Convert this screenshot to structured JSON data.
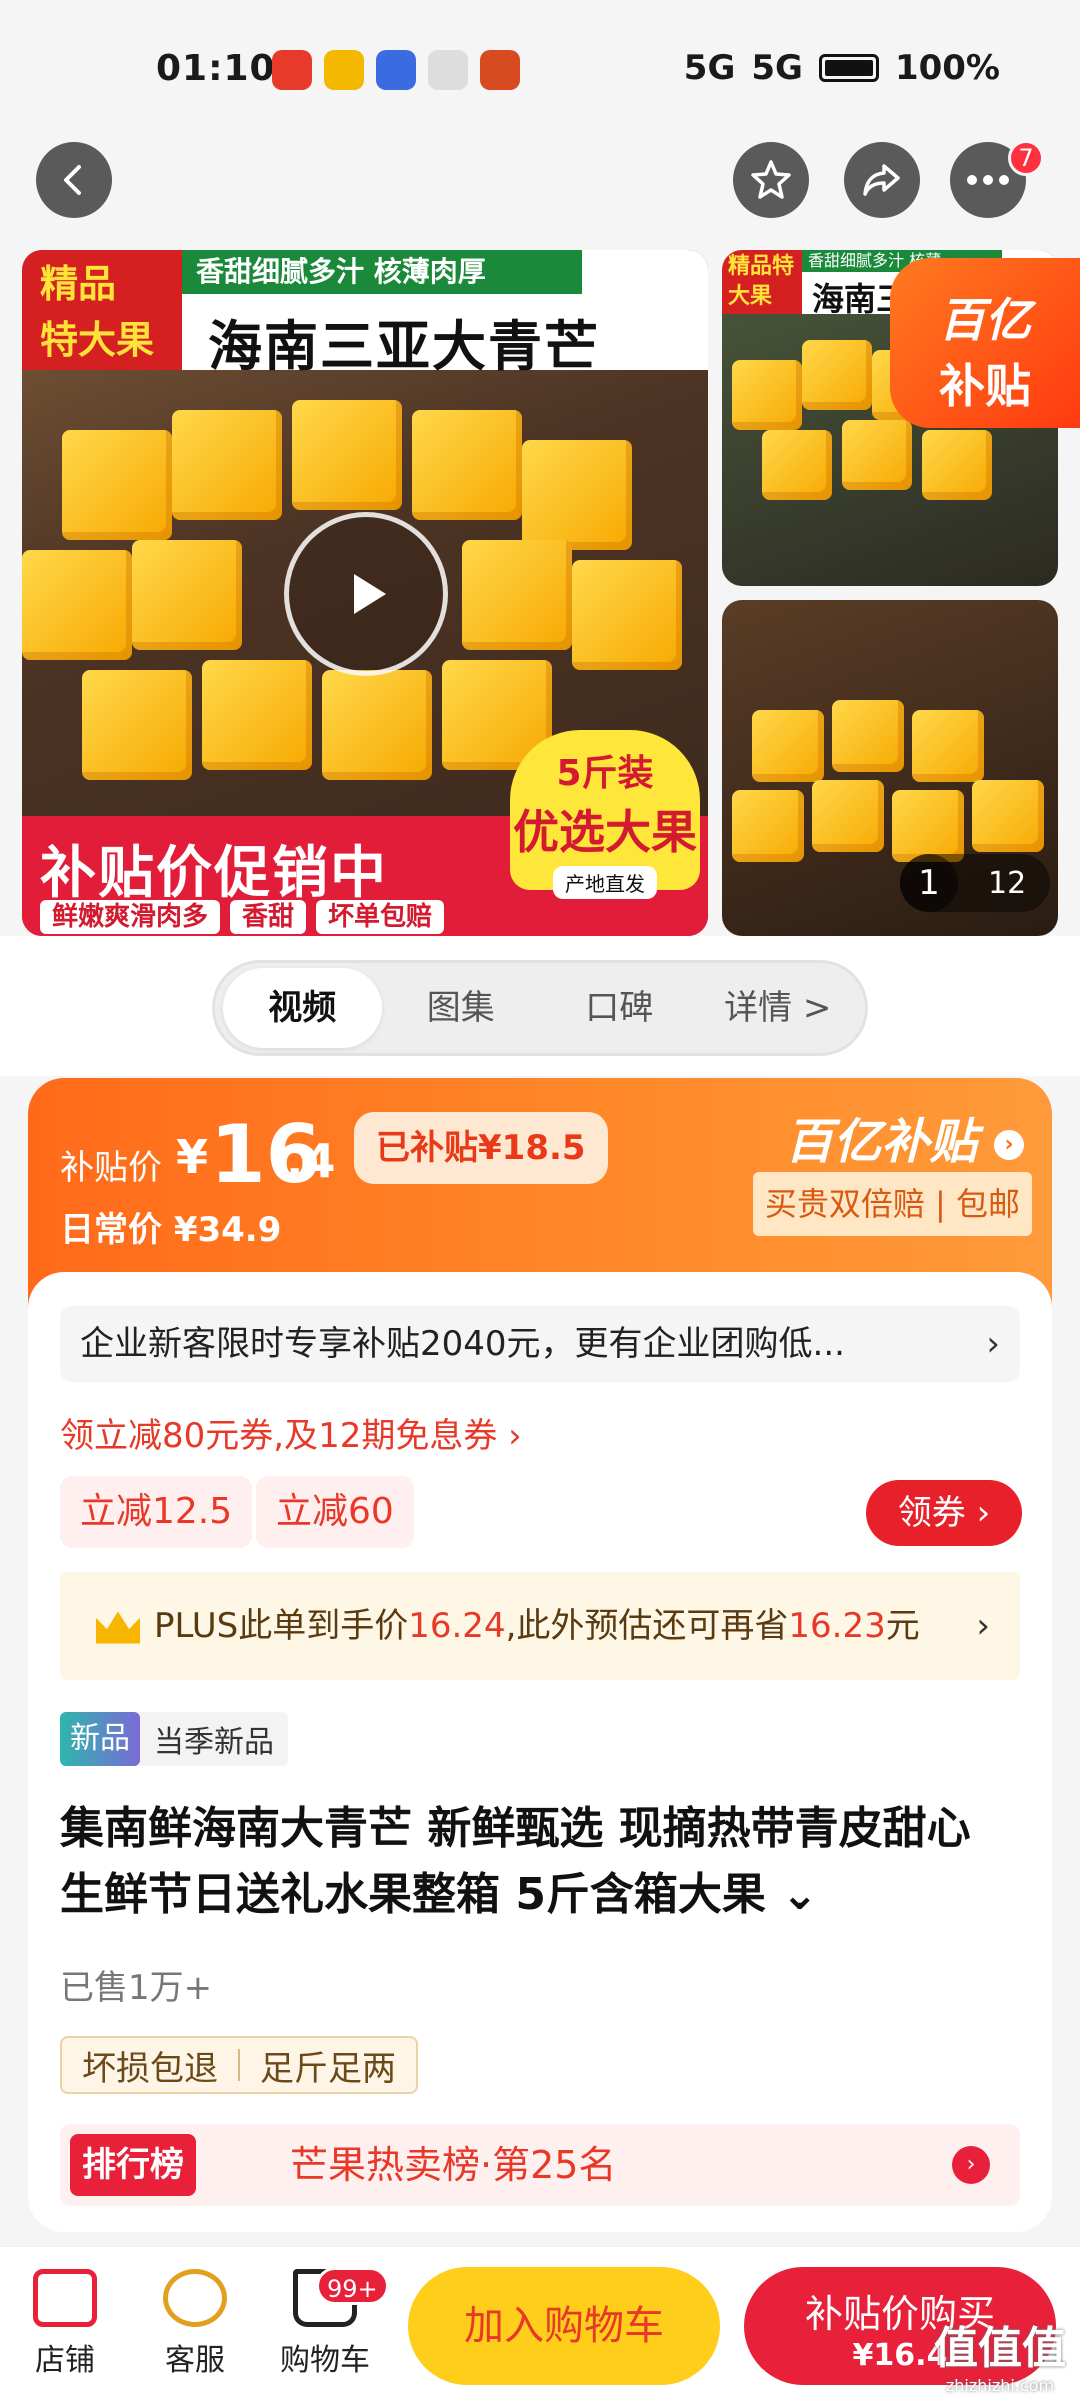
{
  "status_bar": {
    "time": "01:10",
    "signal1": "5G",
    "signal2": "5G",
    "battery": "100%"
  },
  "nav": {
    "back_icon": "back-arrow-icon",
    "favorite_icon": "star-icon",
    "share_icon": "share-icon",
    "more_icon": "more-icon",
    "more_badge": "7"
  },
  "gallery": {
    "main_tag_1": "精品",
    "main_tag_2": "特大果",
    "green_banner": "香甜细腻多汁  核薄肉厚",
    "main_title": "海南三亚大青芒",
    "bottom_title": "补贴价促销中",
    "bottom_chips": [
      "鲜嫩爽滑肉多",
      "香甜",
      "坏单包赔"
    ],
    "badge_line1": "5斤装",
    "badge_line2": "优选大果",
    "badge_line3": "产地直发",
    "thumb1_tag": "精品特大果",
    "thumb1_green": "香甜细腻多汁  核薄",
    "thumb1_title": "海南三",
    "subsidy_badge_1": "百亿",
    "subsidy_badge_2": "补贴",
    "counter_current": "1",
    "counter_total": "12"
  },
  "tabs": [
    "视频",
    "图集",
    "口碑",
    "详情 >"
  ],
  "price": {
    "label": "补贴价",
    "currency": "¥",
    "integer": "16",
    "decimal": ".4",
    "subsidized": "已补贴¥18.5",
    "daily": "日常价 ¥34.9",
    "brand": "百亿补贴",
    "guarantee": "买贵双倍赔 | 包邮"
  },
  "info": {
    "promo_text": "企业新客限时专享补贴2040元，更有企业团购低...",
    "coupon_line": "领立减80元券,及12期免息券 ›",
    "chip1": "立减12.5",
    "chip2": "立减60",
    "get_coupon": "领券",
    "plus_pre": "PLUS此单到手价",
    "plus_price": "16.24",
    "plus_mid": ",此外预估还可再省",
    "plus_save": "16.23",
    "plus_post": "元",
    "new_tag": "新品",
    "new_tag_text": "当季新品",
    "title": "集南鲜海南大青芒 新鲜甄选 现摘热带青皮甜心 生鲜节日送礼水果整箱 5斤含箱大果 ⌄",
    "sold": "已售1万+",
    "service1": "坏损包退",
    "service2": "足斤足两",
    "rank_badge": "排行榜",
    "rank_text": "芒果热卖榜·第25名"
  },
  "bottom_bar": {
    "shop": "店铺",
    "service": "客服",
    "cart": "购物车",
    "cart_badge": "99+",
    "add_cart": "加入购物车",
    "buy_line1": "补贴价购买",
    "buy_line2": "¥16.4"
  },
  "watermark": {
    "logo": "值值值",
    "site": "zhizhizhi.com"
  }
}
